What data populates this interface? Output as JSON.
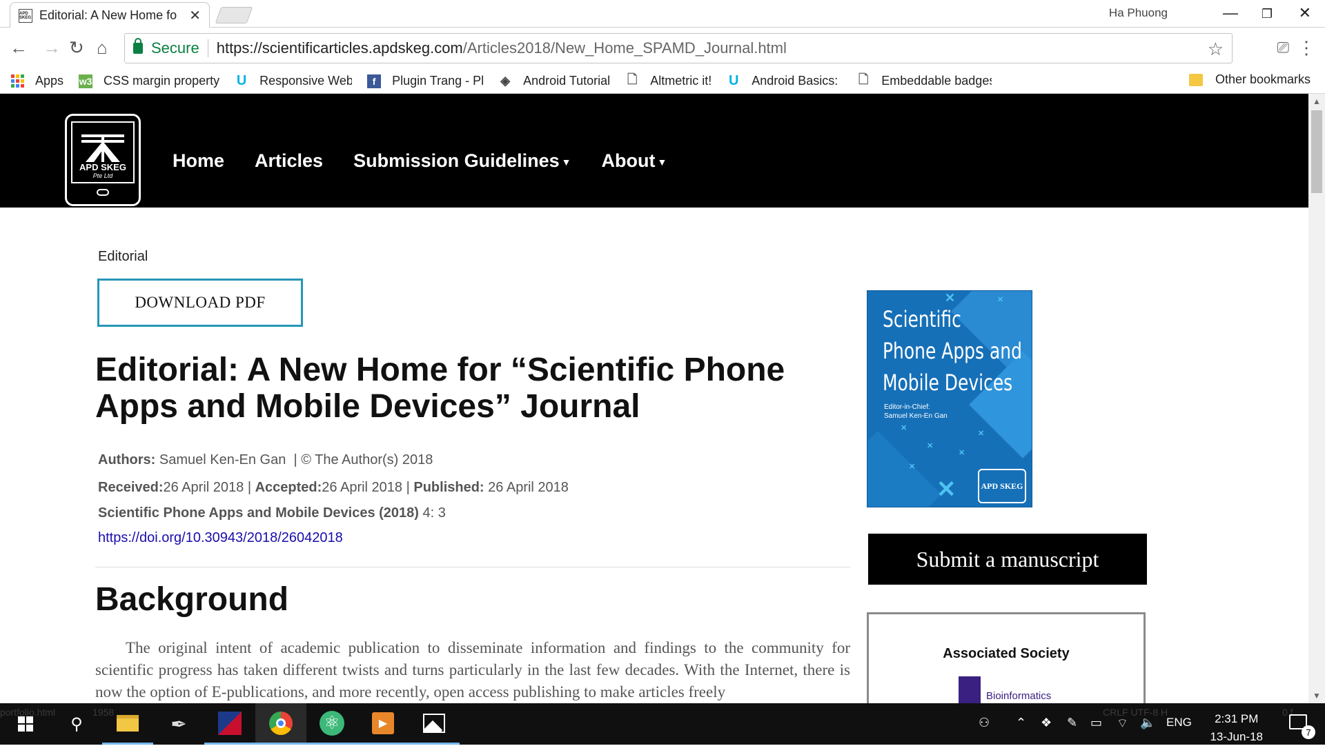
{
  "browser": {
    "tab_title": "Editorial: A New Home fo",
    "tab_favicon_text": "APD SKEG",
    "profile_name": "Ha Phuong",
    "secure_label": "Secure",
    "url_host": "https://scientificarticles.apdskeg.com",
    "url_path": "/Articles2018/New_Home_SPAMD_Journal.html",
    "bookmarks": [
      {
        "label": "Apps",
        "icon": "apps-grid-icon"
      },
      {
        "label": "CSS margin property",
        "icon": "w3schools-icon",
        "color": "#6ab04c"
      },
      {
        "label": "Responsive Web Des",
        "icon": "udacity-icon",
        "color": "#02b3e4"
      },
      {
        "label": "Plugin Trang - Plugir",
        "icon": "facebook-icon",
        "color": "#3b5998"
      },
      {
        "label": "Android Tutorial",
        "icon": "diamond-icon",
        "color": "#444444"
      },
      {
        "label": "Altmetric it!",
        "icon": "page-icon",
        "color": "#666666"
      },
      {
        "label": "Android Basics: User",
        "icon": "udacity-icon",
        "color": "#02b3e4"
      },
      {
        "label": "Embeddable badges",
        "icon": "page-icon",
        "color": "#666666"
      }
    ],
    "other_bookmarks": "Other bookmarks"
  },
  "site": {
    "logo_name": "APD SKEG",
    "logo_sub": "Pte Ltd",
    "nav": [
      {
        "label": "Home",
        "dropdown": false
      },
      {
        "label": "Articles",
        "dropdown": false
      },
      {
        "label": "Submission Guidelines",
        "dropdown": true
      },
      {
        "label": "About",
        "dropdown": true
      }
    ]
  },
  "article": {
    "kicker": "Editorial",
    "download_label": "DOWNLOAD PDF",
    "title": "Editorial: A New Home for “Scientific Phone Apps and Mobile Devices” Journal",
    "authors_label": "Authors:",
    "authors_value": "Samuel Ken-En Gan",
    "copyright": "| © The Author(s) 2018",
    "received_label": "Received:",
    "received_value": "26 April 2018",
    "accepted_label": "Accepted:",
    "accepted_value": "26 April 2018",
    "published_label": "Published:",
    "published_value": "26 April 2018",
    "journal_label": "Scientific Phone Apps and Mobile Devices (2018)",
    "journal_value": "4: 3",
    "doi": "https://doi.org/10.30943/2018/26042018",
    "section_heading": "Background",
    "body": "The original intent of academic publication to disseminate information and findings to the community for scientific progress has taken different twists and turns particularly in the last few decades. With the Internet, there is now the option of E-publications, and more recently, open access publishing to make articles freely"
  },
  "sidebar": {
    "cover_title_lines": [
      "Scientific",
      "Phone Apps and",
      "Mobile Devices"
    ],
    "cover_editor_label": "Editor-in-Chief:",
    "cover_editor_name": "Samuel Ken-En Gan",
    "cover_logo": "APD SKEG",
    "submit_label": "Submit a manuscript",
    "assoc_title": "Associated Society",
    "assoc_name": "Bioinformatics"
  },
  "taskbar": {
    "ghost_left": "portfolio.html",
    "ghost_num": "1958",
    "ghost_right": "CRLF     UTF-8     H",
    "ghost_far": "0 f",
    "language": "ENG",
    "time": "2:31 PM",
    "date": "13-Jun-18",
    "notifications": "7"
  }
}
